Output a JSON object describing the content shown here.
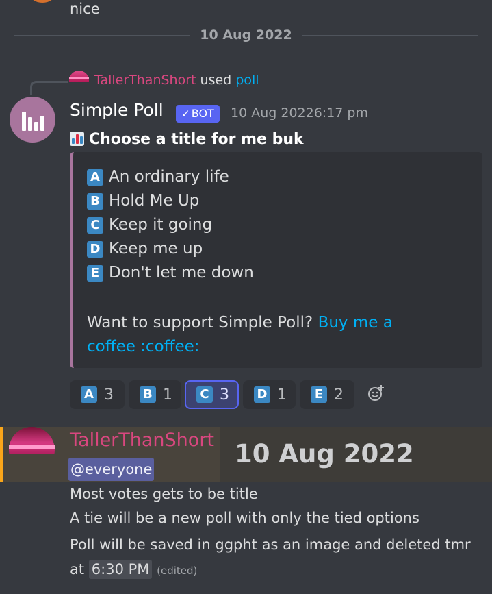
{
  "previous_message": {
    "text": "nice"
  },
  "divider": {
    "date": "10 Aug 2022"
  },
  "interaction": {
    "user": "TallerThanShort",
    "verb": "used",
    "command": "poll"
  },
  "bot_message": {
    "author": "Simple Poll",
    "tag": "BOT",
    "date": "10 Aug 2022",
    "time": "6:17 pm",
    "title": "Choose a title for me buk",
    "options": [
      {
        "letter": "A",
        "text": "An ordinary life"
      },
      {
        "letter": "B",
        "text": "Hold Me Up"
      },
      {
        "letter": "C",
        "text": "Keep it going"
      },
      {
        "letter": "D",
        "text": "Keep me up"
      },
      {
        "letter": "E",
        "text": "Don't let me down"
      }
    ],
    "support_text": "Want to support Simple Poll?",
    "support_link": "Buy me a coffee :coffee:",
    "accent_color": "#a8759d"
  },
  "reactions": [
    {
      "letter": "A",
      "count": "3",
      "active": false
    },
    {
      "letter": "B",
      "count": "1",
      "active": false
    },
    {
      "letter": "C",
      "count": "3",
      "active": true
    },
    {
      "letter": "D",
      "count": "1",
      "active": false
    },
    {
      "letter": "E",
      "count": "2",
      "active": false
    }
  ],
  "mention_message": {
    "author": "TallerThanShort",
    "date_overlay": "10 Aug 2022",
    "mention": "@everyone",
    "lines": [
      "Most votes gets to be title",
      "A tie will be a new poll with only the tied options",
      "Poll will be saved in ggpht as an image and deleted tmr"
    ],
    "last_line_prefix": "at",
    "last_line_time": "6:30 PM",
    "edited": "(edited)",
    "highlight_color": "#faa61a"
  }
}
